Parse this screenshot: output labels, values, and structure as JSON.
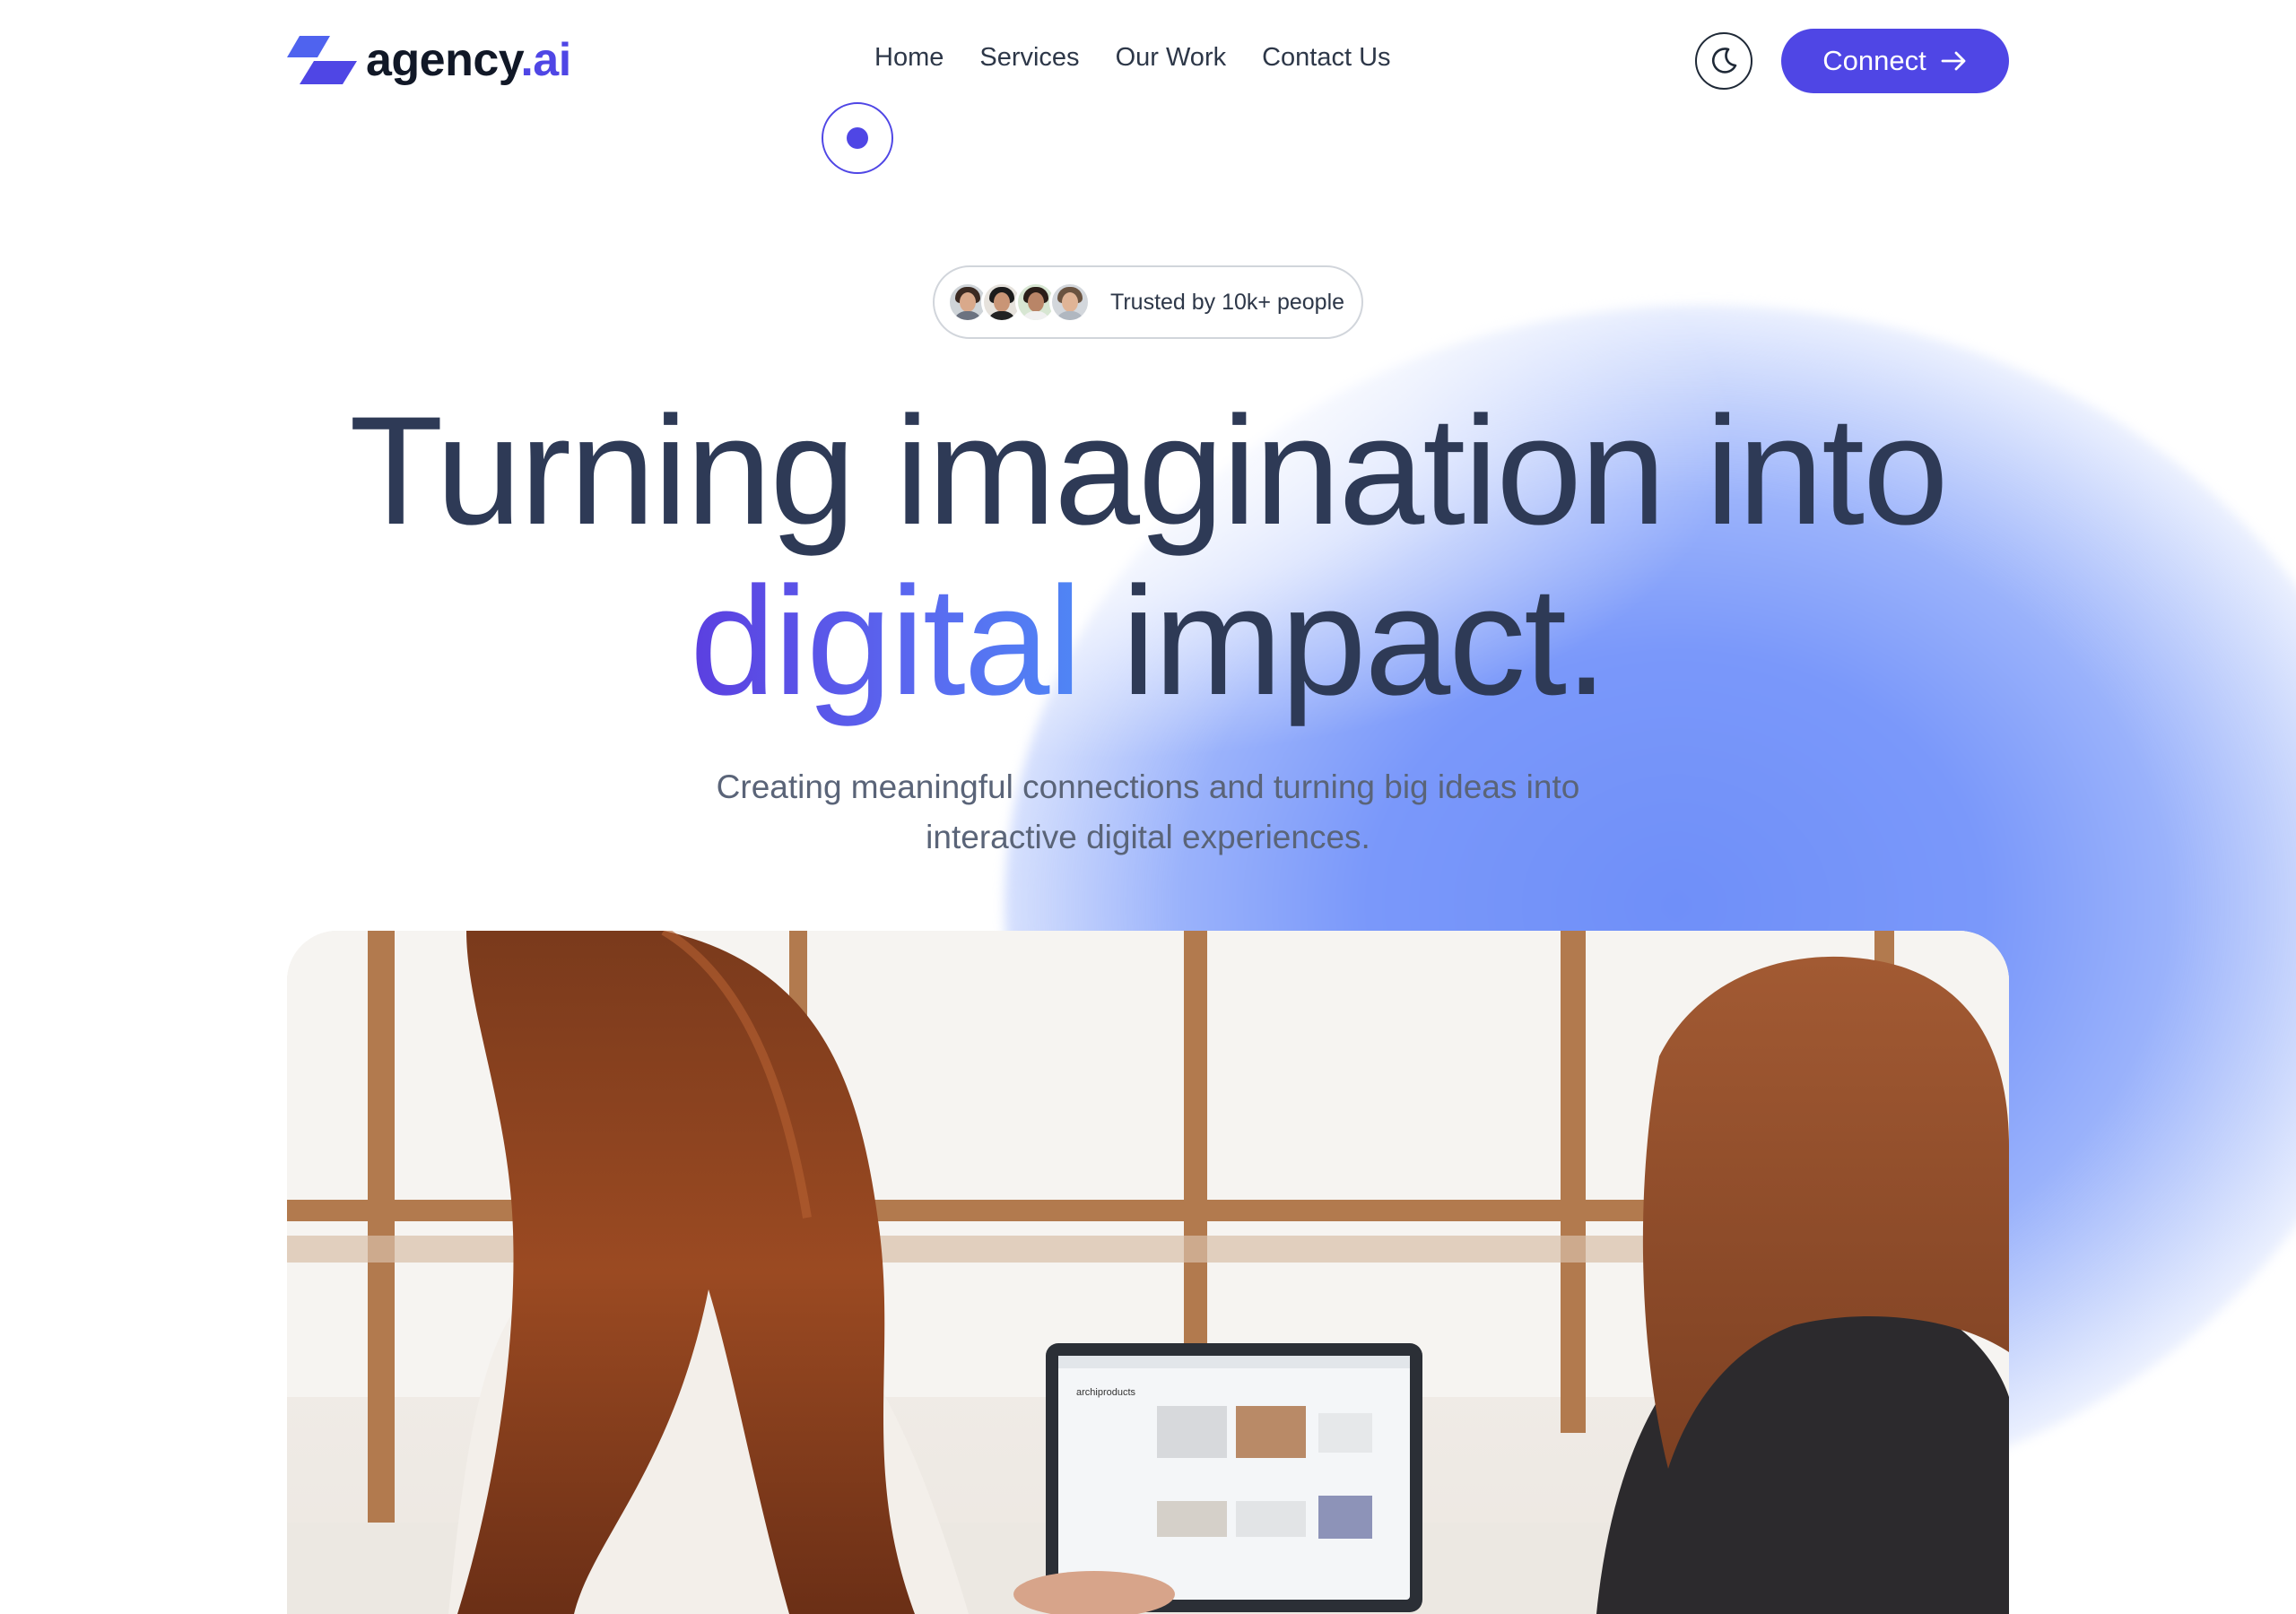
{
  "header": {
    "logo": {
      "name": "agency",
      "suffix": ".ai"
    },
    "nav": [
      {
        "label": "Home"
      },
      {
        "label": "Services"
      },
      {
        "label": "Our Work"
      },
      {
        "label": "Contact Us"
      }
    ],
    "connect_label": "Connect",
    "theme_toggle_icon": "moon-icon",
    "connect_icon": "arrow-right-icon"
  },
  "hero": {
    "trusted_text": "Trusted by 10k+ people",
    "headline_line1": "Turning imagination into",
    "headline_accent": "digital",
    "headline_rest": "impact.",
    "subtext_line1": "Creating meaningful connections and turning big ideas into",
    "subtext_line2": "interactive digital experiences."
  },
  "laptop_screen": {
    "site_label": "archiproducts"
  },
  "colors": {
    "brand": "#4f46e5",
    "headline": "#2e3a56",
    "blob": "#7a98fa"
  }
}
